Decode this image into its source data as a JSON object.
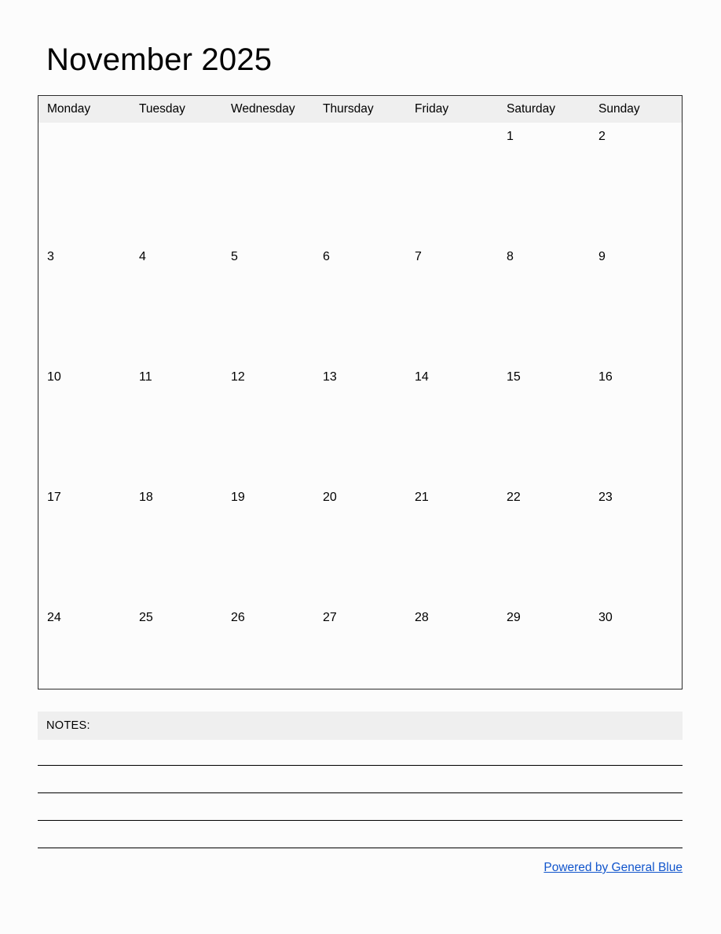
{
  "title": "November 2025",
  "calendar": {
    "month_name": "November",
    "year": "2025",
    "week_start": "Monday",
    "weekday_headers": [
      "Monday",
      "Tuesday",
      "Wednesday",
      "Thursday",
      "Friday",
      "Saturday",
      "Sunday"
    ],
    "weeks": [
      [
        "",
        "",
        "",
        "",
        "",
        "1",
        "2"
      ],
      [
        "3",
        "4",
        "5",
        "6",
        "7",
        "8",
        "9"
      ],
      [
        "10",
        "11",
        "12",
        "13",
        "14",
        "15",
        "16"
      ],
      [
        "17",
        "18",
        "19",
        "20",
        "21",
        "22",
        "23"
      ],
      [
        "24",
        "25",
        "26",
        "27",
        "28",
        "29",
        "30"
      ]
    ]
  },
  "notes": {
    "label": "NOTES:",
    "line_count": 4
  },
  "footer": {
    "link_text": "Powered by General Blue"
  },
  "colors": {
    "page_background": "#fcfcfc",
    "header_band": "#efefef",
    "table_border": "#2b2b2b",
    "text": "#000000",
    "link": "#1155cc",
    "rule": "#000000"
  }
}
